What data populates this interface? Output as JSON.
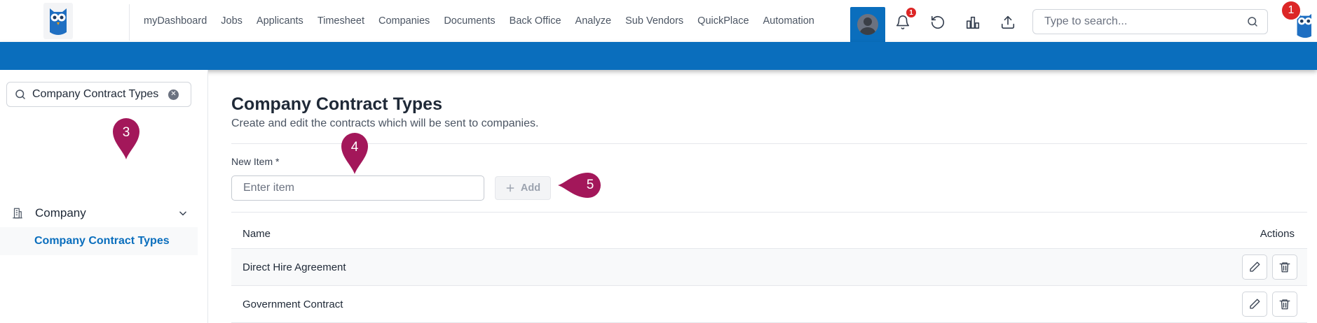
{
  "nav": {
    "items": [
      "myDashboard",
      "Jobs",
      "Applicants",
      "Timesheet",
      "Companies",
      "Documents",
      "Back Office",
      "Analyze",
      "Sub Vendors",
      "QuickPlace",
      "Automation"
    ],
    "notification_count": "1",
    "profile_badge": "1",
    "search_placeholder": "Type to search..."
  },
  "sidebar": {
    "search_value": "Company Contract Types",
    "section_label": "Company",
    "active_item": "Company Contract Types"
  },
  "main": {
    "title": "Company Contract Types",
    "subtitle": "Create and edit the contracts which will be sent to companies.",
    "field_label": "New Item *",
    "input_placeholder": "Enter item",
    "add_label": "Add",
    "table": {
      "headers": [
        "Name",
        "Actions"
      ],
      "rows": [
        {
          "name": "Direct Hire Agreement"
        },
        {
          "name": "Government Contract"
        }
      ]
    }
  },
  "markers": [
    "3",
    "4",
    "5"
  ],
  "colors": {
    "primary": "#0a6ebd",
    "marker": "#a3175a",
    "badge": "#dc2626"
  }
}
